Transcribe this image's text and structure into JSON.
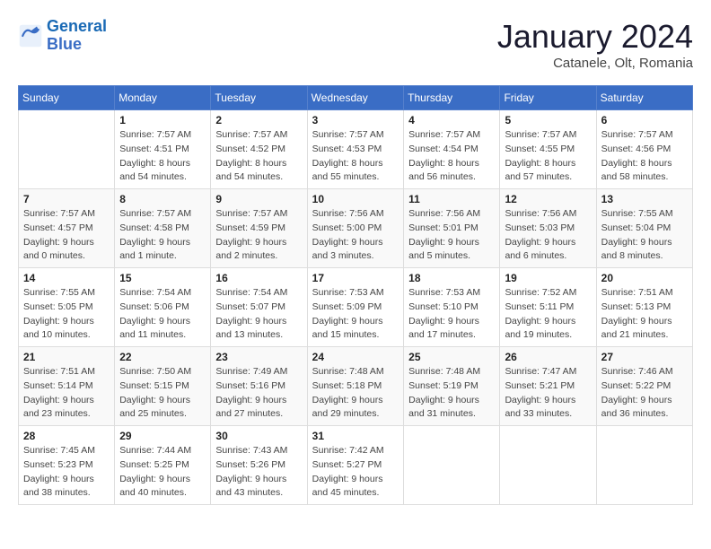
{
  "header": {
    "logo_line1": "General",
    "logo_line2": "Blue",
    "month": "January 2024",
    "location": "Catanele, Olt, Romania"
  },
  "weekdays": [
    "Sunday",
    "Monday",
    "Tuesday",
    "Wednesday",
    "Thursday",
    "Friday",
    "Saturday"
  ],
  "weeks": [
    [
      {
        "day": "",
        "sunrise": "",
        "sunset": "",
        "daylight": ""
      },
      {
        "day": "1",
        "sunrise": "Sunrise: 7:57 AM",
        "sunset": "Sunset: 4:51 PM",
        "daylight": "Daylight: 8 hours and 54 minutes."
      },
      {
        "day": "2",
        "sunrise": "Sunrise: 7:57 AM",
        "sunset": "Sunset: 4:52 PM",
        "daylight": "Daylight: 8 hours and 54 minutes."
      },
      {
        "day": "3",
        "sunrise": "Sunrise: 7:57 AM",
        "sunset": "Sunset: 4:53 PM",
        "daylight": "Daylight: 8 hours and 55 minutes."
      },
      {
        "day": "4",
        "sunrise": "Sunrise: 7:57 AM",
        "sunset": "Sunset: 4:54 PM",
        "daylight": "Daylight: 8 hours and 56 minutes."
      },
      {
        "day": "5",
        "sunrise": "Sunrise: 7:57 AM",
        "sunset": "Sunset: 4:55 PM",
        "daylight": "Daylight: 8 hours and 57 minutes."
      },
      {
        "day": "6",
        "sunrise": "Sunrise: 7:57 AM",
        "sunset": "Sunset: 4:56 PM",
        "daylight": "Daylight: 8 hours and 58 minutes."
      }
    ],
    [
      {
        "day": "7",
        "sunrise": "Sunrise: 7:57 AM",
        "sunset": "Sunset: 4:57 PM",
        "daylight": "Daylight: 9 hours and 0 minutes."
      },
      {
        "day": "8",
        "sunrise": "Sunrise: 7:57 AM",
        "sunset": "Sunset: 4:58 PM",
        "daylight": "Daylight: 9 hours and 1 minute."
      },
      {
        "day": "9",
        "sunrise": "Sunrise: 7:57 AM",
        "sunset": "Sunset: 4:59 PM",
        "daylight": "Daylight: 9 hours and 2 minutes."
      },
      {
        "day": "10",
        "sunrise": "Sunrise: 7:56 AM",
        "sunset": "Sunset: 5:00 PM",
        "daylight": "Daylight: 9 hours and 3 minutes."
      },
      {
        "day": "11",
        "sunrise": "Sunrise: 7:56 AM",
        "sunset": "Sunset: 5:01 PM",
        "daylight": "Daylight: 9 hours and 5 minutes."
      },
      {
        "day": "12",
        "sunrise": "Sunrise: 7:56 AM",
        "sunset": "Sunset: 5:03 PM",
        "daylight": "Daylight: 9 hours and 6 minutes."
      },
      {
        "day": "13",
        "sunrise": "Sunrise: 7:55 AM",
        "sunset": "Sunset: 5:04 PM",
        "daylight": "Daylight: 9 hours and 8 minutes."
      }
    ],
    [
      {
        "day": "14",
        "sunrise": "Sunrise: 7:55 AM",
        "sunset": "Sunset: 5:05 PM",
        "daylight": "Daylight: 9 hours and 10 minutes."
      },
      {
        "day": "15",
        "sunrise": "Sunrise: 7:54 AM",
        "sunset": "Sunset: 5:06 PM",
        "daylight": "Daylight: 9 hours and 11 minutes."
      },
      {
        "day": "16",
        "sunrise": "Sunrise: 7:54 AM",
        "sunset": "Sunset: 5:07 PM",
        "daylight": "Daylight: 9 hours and 13 minutes."
      },
      {
        "day": "17",
        "sunrise": "Sunrise: 7:53 AM",
        "sunset": "Sunset: 5:09 PM",
        "daylight": "Daylight: 9 hours and 15 minutes."
      },
      {
        "day": "18",
        "sunrise": "Sunrise: 7:53 AM",
        "sunset": "Sunset: 5:10 PM",
        "daylight": "Daylight: 9 hours and 17 minutes."
      },
      {
        "day": "19",
        "sunrise": "Sunrise: 7:52 AM",
        "sunset": "Sunset: 5:11 PM",
        "daylight": "Daylight: 9 hours and 19 minutes."
      },
      {
        "day": "20",
        "sunrise": "Sunrise: 7:51 AM",
        "sunset": "Sunset: 5:13 PM",
        "daylight": "Daylight: 9 hours and 21 minutes."
      }
    ],
    [
      {
        "day": "21",
        "sunrise": "Sunrise: 7:51 AM",
        "sunset": "Sunset: 5:14 PM",
        "daylight": "Daylight: 9 hours and 23 minutes."
      },
      {
        "day": "22",
        "sunrise": "Sunrise: 7:50 AM",
        "sunset": "Sunset: 5:15 PM",
        "daylight": "Daylight: 9 hours and 25 minutes."
      },
      {
        "day": "23",
        "sunrise": "Sunrise: 7:49 AM",
        "sunset": "Sunset: 5:16 PM",
        "daylight": "Daylight: 9 hours and 27 minutes."
      },
      {
        "day": "24",
        "sunrise": "Sunrise: 7:48 AM",
        "sunset": "Sunset: 5:18 PM",
        "daylight": "Daylight: 9 hours and 29 minutes."
      },
      {
        "day": "25",
        "sunrise": "Sunrise: 7:48 AM",
        "sunset": "Sunset: 5:19 PM",
        "daylight": "Daylight: 9 hours and 31 minutes."
      },
      {
        "day": "26",
        "sunrise": "Sunrise: 7:47 AM",
        "sunset": "Sunset: 5:21 PM",
        "daylight": "Daylight: 9 hours and 33 minutes."
      },
      {
        "day": "27",
        "sunrise": "Sunrise: 7:46 AM",
        "sunset": "Sunset: 5:22 PM",
        "daylight": "Daylight: 9 hours and 36 minutes."
      }
    ],
    [
      {
        "day": "28",
        "sunrise": "Sunrise: 7:45 AM",
        "sunset": "Sunset: 5:23 PM",
        "daylight": "Daylight: 9 hours and 38 minutes."
      },
      {
        "day": "29",
        "sunrise": "Sunrise: 7:44 AM",
        "sunset": "Sunset: 5:25 PM",
        "daylight": "Daylight: 9 hours and 40 minutes."
      },
      {
        "day": "30",
        "sunrise": "Sunrise: 7:43 AM",
        "sunset": "Sunset: 5:26 PM",
        "daylight": "Daylight: 9 hours and 43 minutes."
      },
      {
        "day": "31",
        "sunrise": "Sunrise: 7:42 AM",
        "sunset": "Sunset: 5:27 PM",
        "daylight": "Daylight: 9 hours and 45 minutes."
      },
      {
        "day": "",
        "sunrise": "",
        "sunset": "",
        "daylight": ""
      },
      {
        "day": "",
        "sunrise": "",
        "sunset": "",
        "daylight": ""
      },
      {
        "day": "",
        "sunrise": "",
        "sunset": "",
        "daylight": ""
      }
    ]
  ]
}
